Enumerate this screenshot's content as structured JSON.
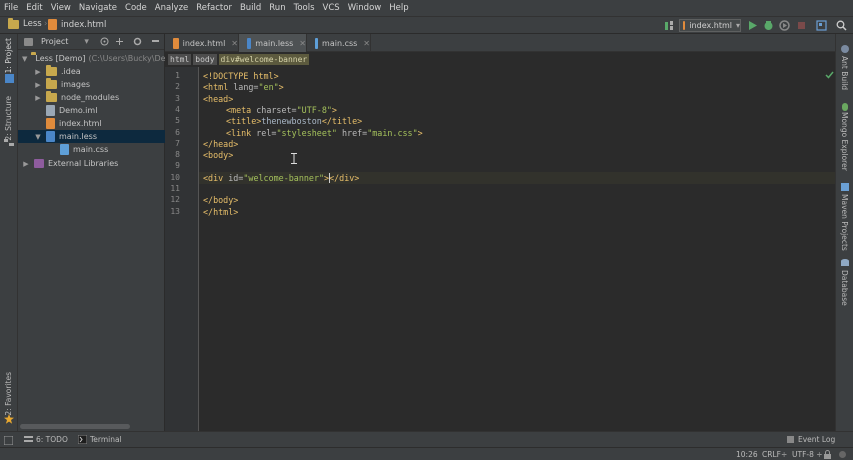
{
  "menu": [
    "File",
    "Edit",
    "View",
    "Navigate",
    "Code",
    "Analyze",
    "Refactor",
    "Build",
    "Run",
    "Tools",
    "VCS",
    "Window",
    "Help"
  ],
  "navbar": {
    "project": "Less",
    "file": "index.html",
    "run_config": "index.html"
  },
  "left_strip": {
    "project_tab": "1: Project",
    "structure_tab": "2: Structure",
    "favorites_tab": "2: Favorites"
  },
  "right_strip": {
    "ant_build": "Ant Build",
    "mongo_explorer": "Mongo Explorer",
    "maven_projects": "Maven Projects",
    "database": "Database"
  },
  "project_panel": {
    "title": "Project",
    "root_name": "Less [Demo]",
    "root_path": "(C:\\Users\\Bucky\\Des",
    "items": [
      {
        "label": "idea",
        "type": "folder",
        "display": ".idea"
      },
      {
        "label": "images",
        "type": "folder",
        "display": "images"
      },
      {
        "label": "node_modules",
        "type": "folder",
        "display": "node_modules"
      },
      {
        "label": "Demo.iml",
        "type": "file",
        "display": "Demo.iml"
      },
      {
        "label": "index.html",
        "type": "html",
        "display": "index.html"
      },
      {
        "label": "main.less",
        "type": "less",
        "display": "main.less"
      },
      {
        "label": "main.css",
        "type": "css",
        "display": "main.css"
      }
    ],
    "external": "External Libraries"
  },
  "tabs": [
    {
      "label": "index.html",
      "active": false
    },
    {
      "label": "main.less",
      "active": true
    },
    {
      "label": "main.css",
      "active": false
    }
  ],
  "breadcrumb": [
    "html",
    "body",
    "div#welcome-banner"
  ],
  "line_numbers": [
    "1",
    "2",
    "3",
    "4",
    "5",
    "6",
    "7",
    "8",
    "9",
    "10",
    "11",
    "12",
    "13"
  ],
  "code": {
    "l1": "<!DOCTYPE html>",
    "l2a": "<html ",
    "l2b": "lang=",
    "l2c": "\"en\"",
    "l2d": ">",
    "l3": "<head>",
    "l4a": "<meta ",
    "l4b": "charset=",
    "l4c": "\"UTF-8\"",
    "l4d": ">",
    "l5a": "<title>",
    "l5b": "thenewboston",
    "l5c": "</title>",
    "l6a": "<link ",
    "l6b": "rel=",
    "l6c": "\"stylesheet\"",
    "l6d": " href=",
    "l6e": "\"main.css\"",
    "l6f": ">",
    "l7": "</head>",
    "l8": "<body>",
    "l10a": "<div ",
    "l10b": "id=",
    "l10c": "\"welcome-banner\"",
    "l10d": ">",
    "l10e": "</div>",
    "l12": "</body>",
    "l13": "</html>"
  },
  "bottom": {
    "todo": "6: TODO",
    "terminal": "Terminal",
    "event_log": "Event Log"
  },
  "status": {
    "position": "10:26",
    "line_sep": "CRLF÷",
    "encoding": "UTF-8 ÷"
  },
  "colors": {
    "accent_run": "#59a869",
    "selection": "#0d293e"
  }
}
